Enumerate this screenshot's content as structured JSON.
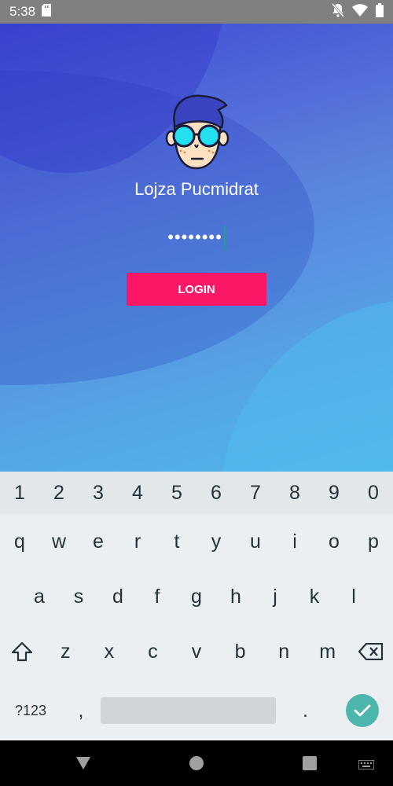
{
  "status_bar": {
    "time": "5:38"
  },
  "login": {
    "username": "Lojza Pucmidrat",
    "password_masked": "••••••••",
    "button_label": "LOGIN"
  },
  "keyboard": {
    "number_row": [
      "1",
      "2",
      "3",
      "4",
      "5",
      "6",
      "7",
      "8",
      "9",
      "0"
    ],
    "row1": [
      "q",
      "w",
      "e",
      "r",
      "t",
      "y",
      "u",
      "i",
      "o",
      "p"
    ],
    "row2": [
      "a",
      "s",
      "d",
      "f",
      "g",
      "h",
      "j",
      "k",
      "l"
    ],
    "row3": [
      "z",
      "x",
      "c",
      "v",
      "b",
      "n",
      "m"
    ],
    "symbols_key": "?123",
    "comma_key": ",",
    "period_key": "."
  },
  "colors": {
    "accent_button": "#fc1767",
    "enter_key": "#4db6ac"
  }
}
